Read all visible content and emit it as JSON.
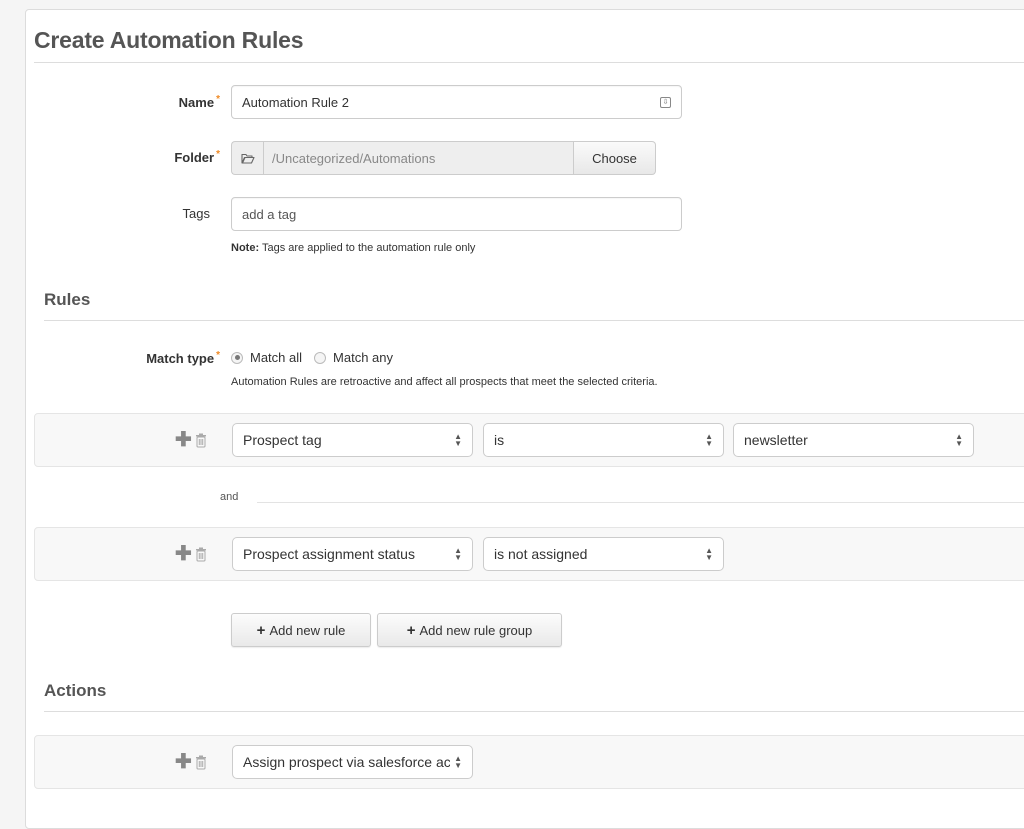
{
  "page": {
    "title": "Create Automation Rules"
  },
  "form": {
    "name": {
      "label": "Name",
      "required_mark": "*",
      "value": "Automation Rule 2",
      "icon": "field-options-icon"
    },
    "folder": {
      "label": "Folder",
      "required_mark": "*",
      "value": "/Uncategorized/Automations",
      "icon": "folder-open-icon",
      "button_label": "Choose"
    },
    "tags": {
      "label": "Tags",
      "placeholder": "add a tag",
      "note_bold": "Note:",
      "note_text": " Tags are applied to the automation rule only"
    }
  },
  "rules": {
    "section_title": "Rules",
    "match_type": {
      "label": "Match type",
      "required_mark": "*",
      "options": [
        {
          "label": "Match all",
          "checked": true
        },
        {
          "label": "Match any",
          "checked": false
        }
      ],
      "help_text": "Automation Rules are retroactive and affect all prospects that meet the selected criteria."
    },
    "rows": [
      {
        "field": "Prospect tag",
        "operator": "is",
        "value": "newsletter"
      },
      {
        "field": "Prospect assignment status",
        "operator": "is not assigned"
      }
    ],
    "conjunction": "and",
    "add_rule_label": "Add new rule",
    "add_rule_group_label": "Add new rule group",
    "plus_glyph": "+"
  },
  "actions": {
    "section_title": "Actions",
    "rows": [
      {
        "action": "Assign prospect via salesforce active assignment rule"
      }
    ]
  }
}
